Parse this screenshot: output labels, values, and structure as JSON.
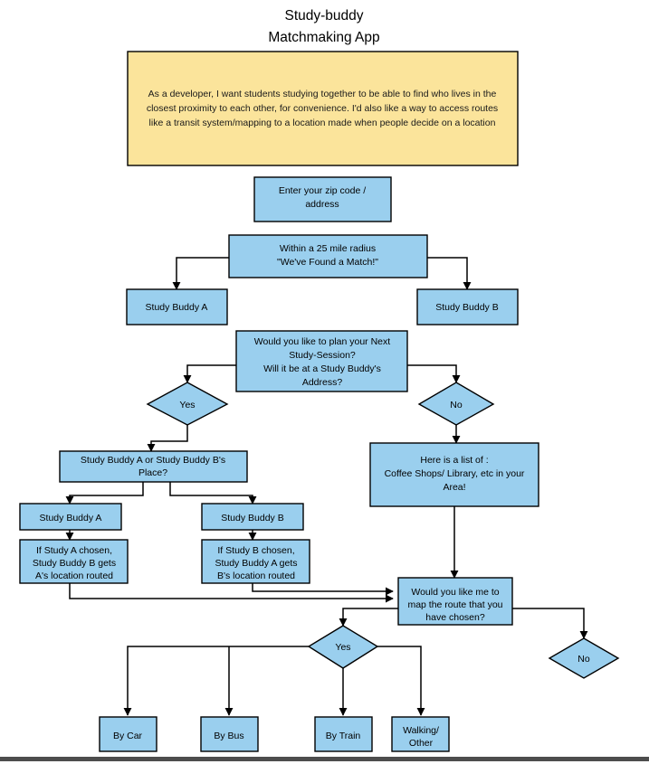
{
  "diagram": {
    "type": "flowchart",
    "title_line1": "Study-buddy",
    "title_line2": "Matchmaking App",
    "colors": {
      "node_fill": "#9ACFEE",
      "note_fill": "#FBE49B",
      "stroke": "#000000",
      "footer_bar": "#4d4d4d",
      "background": "#ffffff"
    },
    "note": {
      "line1": "As a developer, I want students studying together to be able to find who lives in the",
      "line2": "closest proximity to each other, for convenience. I'd also like a way to access routes",
      "line3": "like a transit system/mapping to a location made when people decide on a location"
    },
    "nodes": {
      "zip": {
        "line1": "Enter your zip code /",
        "line2": "address"
      },
      "radius": {
        "line1": "Within a 25 mile radius",
        "line2": "\"We've Found a Match!\""
      },
      "buddy_a_top": {
        "line1": "Study Buddy A"
      },
      "buddy_b_top": {
        "line1": "Study Buddy B"
      },
      "plan": {
        "line1": "Would you like to plan your Next",
        "line2": "Study-Session?",
        "line3": "Will it be at a Study Buddy's",
        "line4": "Address?"
      },
      "yes_plan": {
        "line1": "Yes"
      },
      "no_plan": {
        "line1": "No"
      },
      "place_choice": {
        "line1": "Study Buddy A  or Study Buddy B's",
        "line2": "Place?"
      },
      "list_places": {
        "line1": "Here is a list of :",
        "line2": "Coffee Shops/ Library, etc in your",
        "line3": "Area!"
      },
      "buddy_a_mid": {
        "line1": "Study Buddy A"
      },
      "buddy_b_mid": {
        "line1": "Study Buddy B"
      },
      "if_a": {
        "line1": "If Study A chosen,",
        "line2": "Study Buddy B gets",
        "line3": "A's location routed"
      },
      "if_b": {
        "line1": "If Study B chosen,",
        "line2": "Study Buddy A gets",
        "line3": "B's location routed"
      },
      "map_route": {
        "line1": "Would you like me to",
        "line2": "map the route that you",
        "line3": "have chosen?"
      },
      "yes_route": {
        "line1": "Yes"
      },
      "no_route": {
        "line1": "No"
      },
      "by_car": {
        "line1": "By Car"
      },
      "by_bus": {
        "line1": "By Bus"
      },
      "by_train": {
        "line1": "By Train"
      },
      "walking_other": {
        "line1": "Walking/",
        "line2": "Other"
      }
    }
  }
}
